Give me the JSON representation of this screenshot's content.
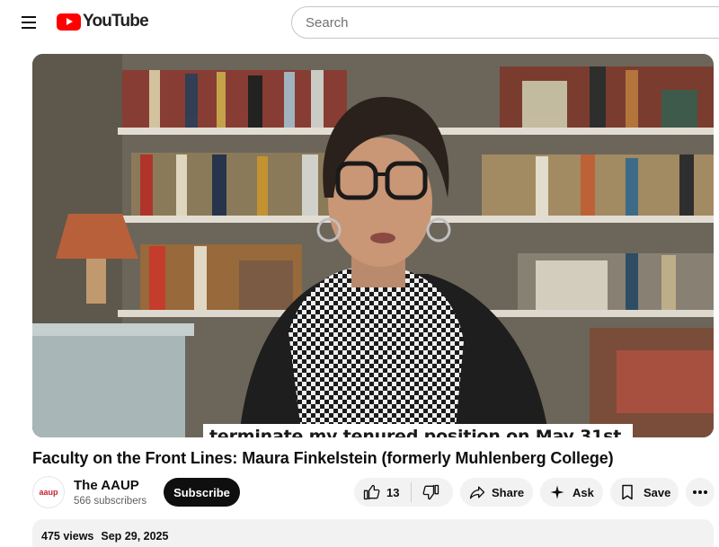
{
  "header": {
    "logo_text": "YouTube",
    "search_placeholder": "Search"
  },
  "player": {
    "caption": "terminate my tenured position on May 31st,"
  },
  "video": {
    "title": "Faculty on the Front Lines: Maura Finkelstein (formerly Muhlenberg College)"
  },
  "channel": {
    "avatar_text": "aaup",
    "name": "The AAUP",
    "subscribers": "566 subscribers",
    "subscribe_label": "Subscribe"
  },
  "actions": {
    "like_count": "13",
    "share_label": "Share",
    "ask_label": "Ask",
    "save_label": "Save"
  },
  "description": {
    "views": "475 views",
    "date": "Sep 29, 2025"
  },
  "colors": {
    "brand_red": "#ff0000",
    "subscribe_bg": "#0f0f0f",
    "pill_bg": "#f2f2f2"
  }
}
